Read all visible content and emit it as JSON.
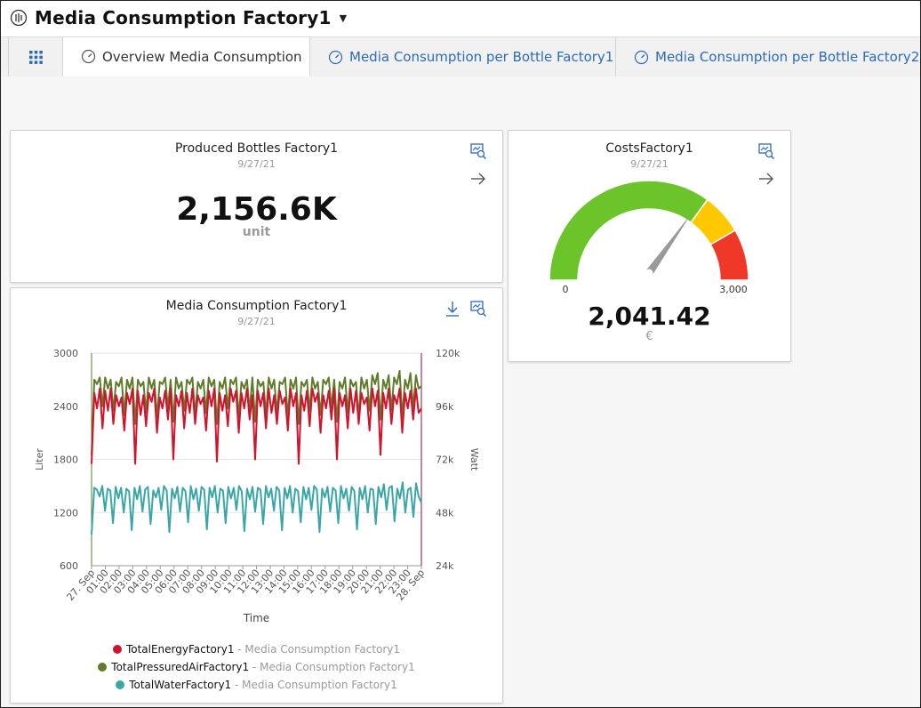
{
  "app": {
    "title": "Media Consumption Factory1",
    "tabs": [
      {
        "label": "Overview Media Consumption",
        "active": true
      },
      {
        "label": "Media Consumption per Bottle Factory1",
        "active": false
      },
      {
        "label": "Media Consumption per Bottle Factory2",
        "active": false
      }
    ]
  },
  "colors": {
    "link": "#2d6bb5",
    "energy": "#d0142c",
    "air": "#5e7c2a",
    "water": "#3aa7a6",
    "gauge_green": "#6bc52a",
    "gauge_yellow": "#ffc800",
    "gauge_red": "#f03828"
  },
  "kpi": {
    "title": "Produced Bottles Factory1",
    "date": "9/27/21",
    "value": "2,156.6K",
    "unit": "unit"
  },
  "gauge": {
    "title": "CostsFactory1",
    "date": "9/27/21",
    "min_label": "0",
    "max_label": "3,000",
    "min": 0,
    "max": 3000,
    "value": 2041.42,
    "value_text": "2,041.42",
    "unit": "€",
    "bands": [
      {
        "from": 0,
        "to": 2100,
        "color": "green"
      },
      {
        "from": 2100,
        "to": 2500,
        "color": "yellow"
      },
      {
        "from": 2500,
        "to": 3000,
        "color": "red"
      }
    ]
  },
  "chart": {
    "title": "Media Consumption Factory1",
    "date": "9/27/21",
    "legend": [
      {
        "name": "TotalEnergyFactory1",
        "suffix": " - Media Consumption Factory1",
        "color": "#d0142c"
      },
      {
        "name": "TotalPressuredAirFactory1",
        "suffix": " - Media Consumption Factory1",
        "color": "#5e7c2a"
      },
      {
        "name": "TotalWaterFactory1",
        "suffix": " - Media Consumption Factory1",
        "color": "#3aa7a6"
      }
    ]
  },
  "chart_data": {
    "type": "line",
    "title": "Media Consumption Factory1",
    "xlabel": "Time",
    "ylabel": "Liter",
    "y2label": "Watt",
    "ylim": [
      600,
      3000
    ],
    "y2lim": [
      24000,
      120000
    ],
    "yticks": [
      "3000",
      "2400",
      "1800",
      "1200",
      "600"
    ],
    "y2ticks": [
      "120k",
      "96k",
      "72k",
      "48k",
      "24k"
    ],
    "x_ticks": [
      "27. Sep",
      "01:00",
      "02:00",
      "03:00",
      "04:00",
      "05:00",
      "06:00",
      "07:00",
      "08:00",
      "09:00",
      "10:00",
      "11:00",
      "12:00",
      "13:00",
      "14:00",
      "15:00",
      "16:00",
      "17:00",
      "18:00",
      "19:00",
      "20:00",
      "21:00",
      "22:00",
      "23:00",
      "28. Sep"
    ],
    "grid": true,
    "legend_position": "bottom",
    "series": [
      {
        "name": "TotalEnergyFactory1",
        "axis": "right",
        "values": [
          70000,
          102000,
          95000,
          104000,
          86000,
          103000,
          94000,
          104000,
          88000,
          101000,
          96000,
          100000,
          85000,
          102000,
          97000,
          104000,
          70000,
          103000,
          92000,
          101000,
          87000,
          102000,
          98000,
          104000,
          84000,
          100000,
          95000,
          103000,
          90000,
          104000,
          72000,
          101000,
          96000,
          103000,
          86000,
          102000,
          93000,
          104000,
          88000,
          101000,
          97000,
          100000,
          85000,
          103000,
          96000,
          104000,
          71000,
          102000,
          94000,
          101000,
          87000,
          104000,
          98000,
          103000,
          84000,
          102000,
          95000,
          104000,
          90000,
          101000,
          72000,
          103000,
          96000,
          102000,
          86000,
          104000,
          93000,
          101000,
          88000,
          103000,
          97000,
          100000,
          85000,
          104000,
          96000,
          102000,
          70000,
          101000,
          94000,
          103000,
          87000,
          104000,
          98000,
          102000,
          84000,
          101000,
          95000,
          103000,
          90000,
          104000,
          72000,
          102000,
          96000,
          101000,
          86000,
          104000,
          93000,
          103000,
          88000,
          102000,
          97000,
          100000,
          85000,
          104000,
          96000,
          103000,
          74000,
          102000,
          95000,
          104000,
          88000,
          101000,
          97000,
          104000,
          84000,
          102000,
          95000,
          103000,
          90000,
          104000,
          93000,
          95000
        ]
      },
      {
        "name": "TotalPressuredAirFactory1",
        "axis": "right",
        "values": [
          74000,
          108000,
          106000,
          109000,
          96000,
          109000,
          104000,
          108000,
          94000,
          107000,
          105000,
          109000,
          92000,
          108000,
          104000,
          109000,
          88000,
          108000,
          105000,
          107000,
          93000,
          109000,
          104000,
          108000,
          91000,
          107000,
          106000,
          109000,
          95000,
          108000,
          89000,
          109000,
          104000,
          107000,
          94000,
          108000,
          106000,
          109000,
          92000,
          107000,
          104000,
          108000,
          93000,
          109000,
          105000,
          108000,
          88000,
          107000,
          104000,
          109000,
          95000,
          108000,
          106000,
          109000,
          91000,
          107000,
          104000,
          108000,
          94000,
          109000,
          89000,
          108000,
          105000,
          107000,
          92000,
          109000,
          104000,
          108000,
          93000,
          107000,
          106000,
          109000,
          91000,
          108000,
          104000,
          109000,
          88000,
          107000,
          105000,
          108000,
          94000,
          109000,
          104000,
          107000,
          92000,
          108000,
          106000,
          109000,
          95000,
          108000,
          89000,
          107000,
          104000,
          109000,
          93000,
          108000,
          105000,
          107000,
          91000,
          109000,
          104000,
          108000,
          94000,
          110000,
          106000,
          111000,
          90000,
          108000,
          104000,
          110000,
          94000,
          109000,
          106000,
          112000,
          91000,
          108000,
          104000,
          111000,
          95000,
          110000,
          104000,
          105000
        ]
      },
      {
        "name": "TotalWaterFactory1",
        "axis": "left",
        "values": [
          950,
          1480,
          1460,
          1380,
          1500,
          1220,
          1470,
          1450,
          1080,
          1490,
          1360,
          1480,
          1200,
          1470,
          1440,
          1000,
          1480,
          1350,
          1500,
          1210,
          1460,
          1490,
          1070,
          1450,
          1370,
          1480,
          1230,
          1500,
          1450,
          980,
          1470,
          1360,
          1490,
          1210,
          1480,
          1440,
          1090,
          1500,
          1350,
          1470,
          1220,
          1490,
          1460,
          1010,
          1480,
          1370,
          1500,
          1200,
          1470,
          1450,
          1080,
          1490,
          1360,
          1480,
          1230,
          1500,
          1440,
          990,
          1470,
          1350,
          1490,
          1210,
          1480,
          1460,
          1070,
          1500,
          1370,
          1470,
          1220,
          1490,
          1450,
          1000,
          1480,
          1360,
          1500,
          1200,
          1470,
          1440,
          1090,
          1490,
          1350,
          1480,
          1230,
          1500,
          1460,
          980,
          1470,
          1370,
          1490,
          1210,
          1480,
          1450,
          1080,
          1500,
          1360,
          1470,
          1220,
          1490,
          1440,
          1010,
          1480,
          1350,
          1500,
          1200,
          1470,
          1460,
          1070,
          1490,
          1370,
          1520,
          1230,
          1480,
          1500,
          1100,
          1470,
          1360,
          1540,
          1200,
          1460,
          1480,
          1150,
          1530,
          1380,
          1310
        ]
      }
    ]
  }
}
